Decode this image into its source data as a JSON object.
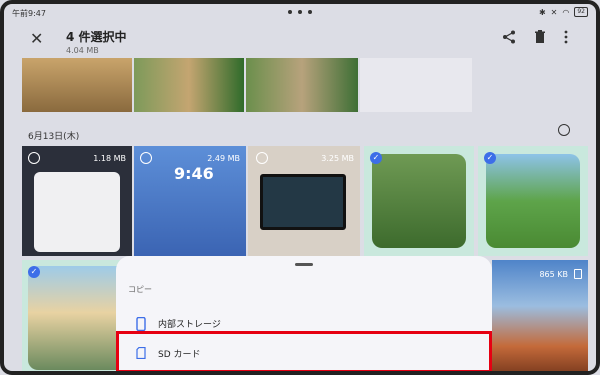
{
  "status": {
    "time": "午前9:47",
    "battery": "92"
  },
  "header": {
    "title": "4 件選択中",
    "size": "4.04 MB"
  },
  "date_header": {
    "label": "6月13日(木)"
  },
  "thumbs": [
    {
      "size": "1.18 MB"
    },
    {
      "size": "2.49 MB",
      "clock": "9:46"
    },
    {
      "size": "3.25 MB"
    },
    {
      "size": "865 KB"
    }
  ],
  "sheet": {
    "heading": "コピー",
    "items": [
      {
        "label": "内部ストレージ",
        "icon": "phone-icon"
      },
      {
        "label": "SD カード",
        "icon": "sd-card-icon"
      }
    ]
  },
  "colors": {
    "highlight": "#e60012",
    "accent": "#3d6ee8",
    "selected_bg": "#c9e8dd"
  }
}
